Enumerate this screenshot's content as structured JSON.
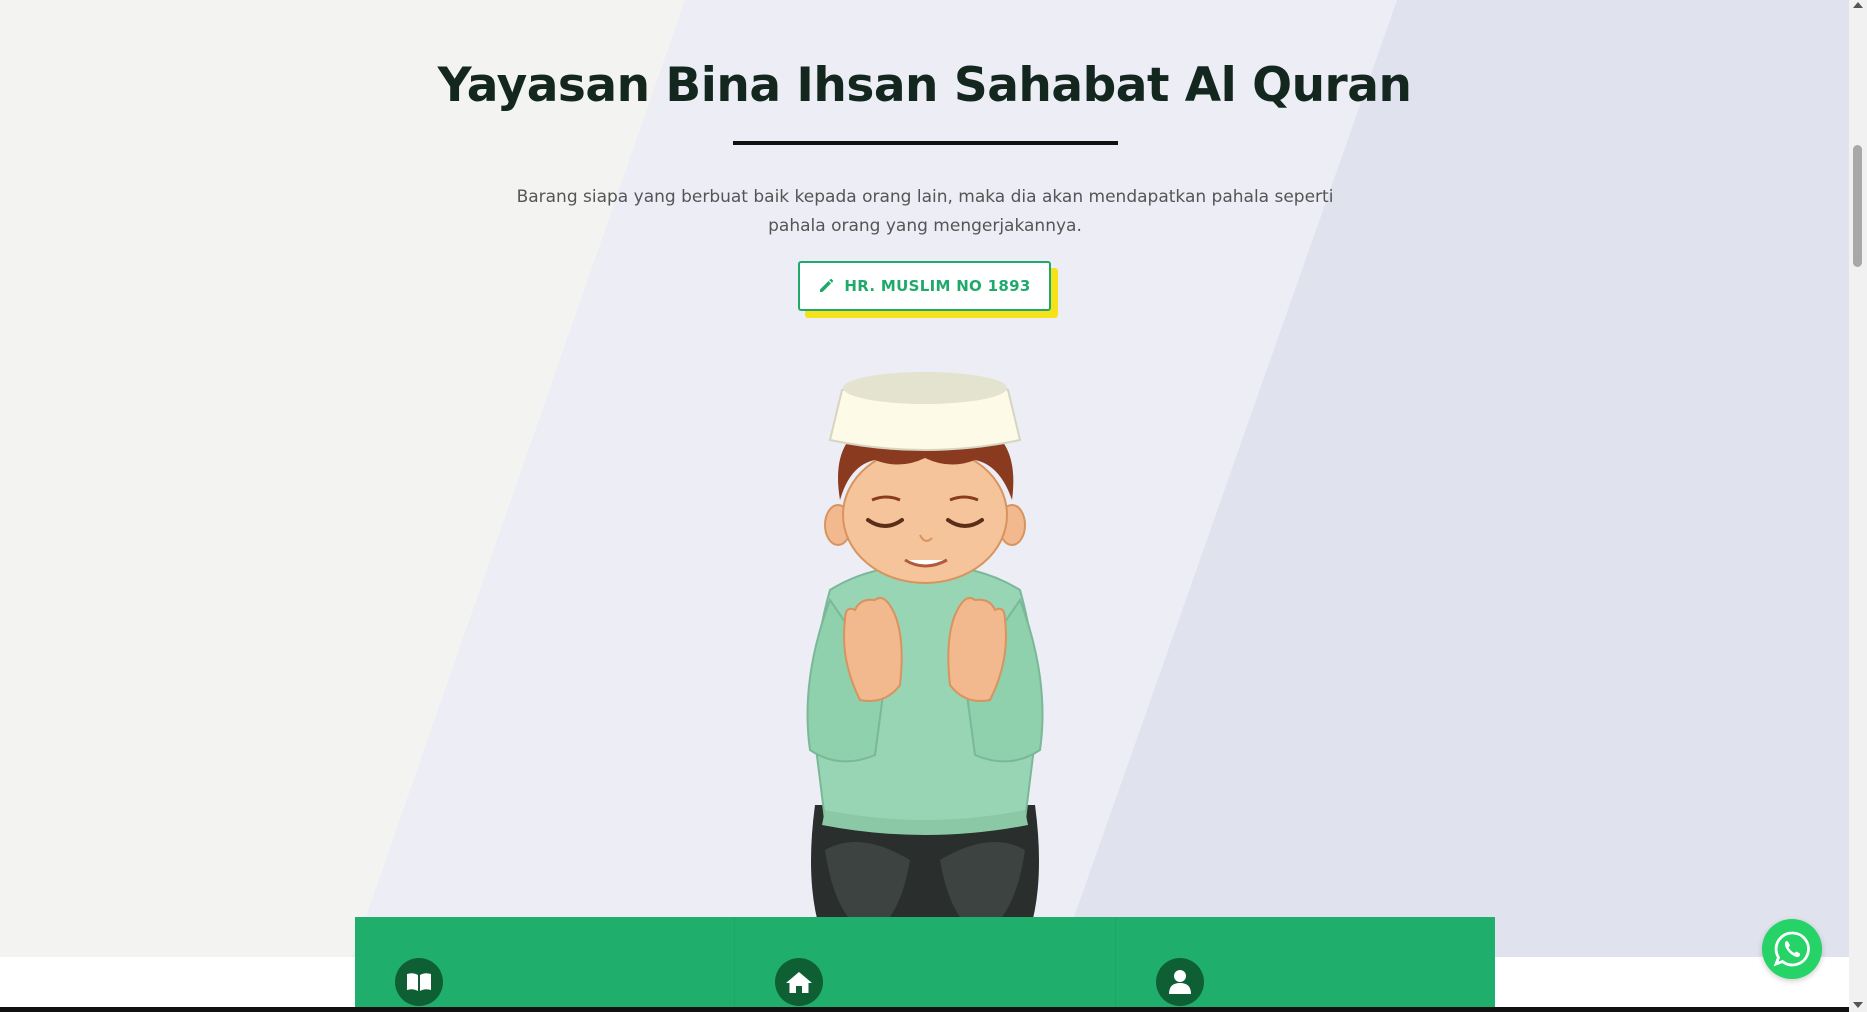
{
  "hero": {
    "title": "Yayasan Bina Ihsan Sahabat Al Quran",
    "subtitle": "Barang siapa yang berbuat baik kepada orang lain, maka dia akan mendapatkan pahala seperti pahala orang yang mengerjakannya.",
    "cta_label": "HR. MUSLIM NO 1893",
    "cta_icon": "pencil-icon",
    "illustration": "praying-boy-illustration"
  },
  "features": [
    {
      "icon": "book-open-icon"
    },
    {
      "icon": "home-icon"
    },
    {
      "icon": "user-icon"
    }
  ],
  "floating": {
    "icon": "whatsapp-icon"
  },
  "colors": {
    "brand_green": "#1fae6b",
    "icon_dark_green": "#0f5f35",
    "cta_shadow_yellow": "#f5e21b",
    "title": "#14271f",
    "whatsapp": "#25d366"
  }
}
